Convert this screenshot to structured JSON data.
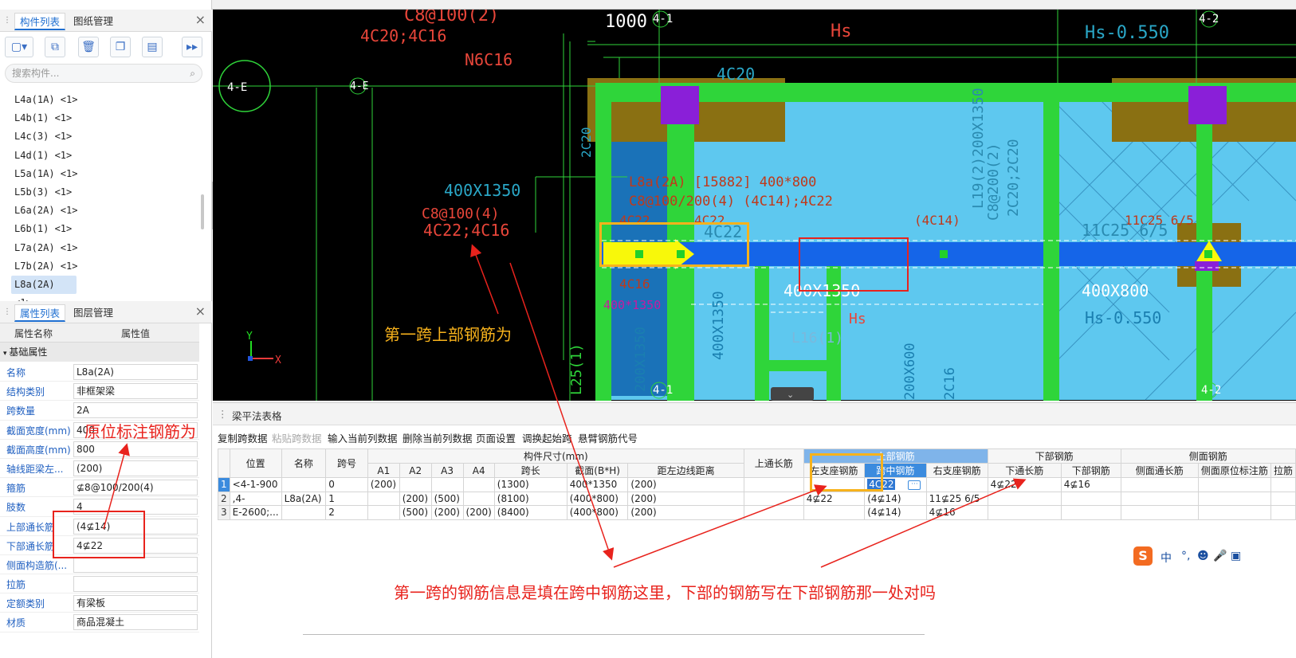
{
  "left_top_panel": {
    "tabs": [
      {
        "label": "构件列表"
      },
      {
        "label": "图纸管理"
      }
    ],
    "close": "×",
    "search_placeholder": "搜索构件...",
    "items": [
      "L4a(1A) <1>",
      "L4b(1) <1>",
      "L4c(3) <1>",
      "L4d(1) <1>",
      "L5a(1A) <1>",
      "L5b(3) <1>",
      "L6a(2A) <1>",
      "L6b(1) <1>",
      "L7a(2A) <1>",
      "L7b(2A) <1>",
      "L8a(2A) <1>"
    ],
    "selected_item": "L8a(2A) <1>"
  },
  "prop_panel": {
    "tabs": [
      {
        "label": "属性列表"
      },
      {
        "label": "图层管理"
      }
    ],
    "close": "×",
    "col_name": "属性名称",
    "col_value": "属性值",
    "group": "基础属性",
    "rows": [
      {
        "name": "名称",
        "value": "L8a(2A)"
      },
      {
        "name": "结构类别",
        "value": "非框架梁"
      },
      {
        "name": "跨数量",
        "value": "2A"
      },
      {
        "name": "截面宽度(mm)",
        "value": "400"
      },
      {
        "name": "截面高度(mm)",
        "value": "800"
      },
      {
        "name": "轴线距梁左...",
        "value": "(200)"
      },
      {
        "name": "箍筋",
        "value": "⊈8@100/200(4)"
      },
      {
        "name": "肢数",
        "value": "4"
      },
      {
        "name": "上部通长筋",
        "value": "(4⊈14)"
      },
      {
        "name": "下部通长筋",
        "value": "4⊈22"
      },
      {
        "name": "侧面构造筋(...",
        "value": ""
      },
      {
        "name": "拉筋",
        "value": ""
      },
      {
        "name": "定额类别",
        "value": "有梁板"
      },
      {
        "name": "材质",
        "value": "商品混凝土"
      }
    ]
  },
  "cad": {
    "labels": {
      "c8_100": "C8@100(2)",
      "c20_16": "4C20;4C16",
      "dim1000": "1000",
      "axis41": "4-1",
      "hs": "Hs",
      "hs055": "Hs-0.550",
      "axis42": "4-2",
      "n6c16": "N6C16",
      "axis4e_circle": "4-E",
      "axis4e": "4-E",
      "c20": "4C20",
      "c20v": "2C20",
      "l19": "L19(2)200X1350",
      "c8_200": "C8@200(2)",
      "c20c20": "2C20;2C20",
      "beam_name": "L8a(2A) [15882] 400*800",
      "beam_stir": "C8@100/200(4) (4C14);4C22",
      "sec400": "400X1350",
      "c8_100_4": "C8@100(4)",
      "c22_16": "4C22;4C16",
      "c22a": "4C22",
      "c22b": "4C22",
      "c22c": "4C22",
      "c14": "(4C14)",
      "c25": "11C25 6/5",
      "c25b": "11C25 6/5",
      "c16": "4C16",
      "sec400b": "400*1350",
      "sec400c": "400X1350",
      "sec400v": "400X1350",
      "sec400d": "400X800",
      "hs2": "Hs",
      "hs055b": "Hs-0.550",
      "l16": "L16(1)",
      "l25": "L25(1)",
      "sec200": "200X1350",
      "sec200b": "200X600",
      "c16v": "2C16",
      "axis41b": "4-1",
      "axis42b": "4-2",
      "y": "Y",
      "x": "X"
    }
  },
  "table_panel": {
    "title": "梁平法表格",
    "toolbar": [
      "复制跨数据",
      "粘贴跨数据",
      "输入当前列数据",
      "删除当前列数据",
      "页面设置",
      "调换起始跨",
      "悬臂钢筋代号"
    ],
    "headers": {
      "pos": "位置",
      "name": "名称",
      "span": "跨号",
      "dims": "构件尺寸(mm)",
      "a1": "A1",
      "a2": "A2",
      "a3": "A3",
      "a4": "A4",
      "len": "跨长",
      "sec": "截面(B*H)",
      "dist": "距左边线距离",
      "top_through": "上通长筋",
      "top_bar": "上部钢筋",
      "left_support": "左支座钢筋",
      "mid": "跨中钢筋",
      "right_support": "右支座钢筋",
      "bottom_bar": "下部钢筋",
      "bottom_through": "下通长筋",
      "bottom": "下部钢筋",
      "side_bar": "侧面钢筋",
      "side_through": "侧面通长筋",
      "side_orig": "侧面原位标注筋",
      "tie": "拉筋"
    },
    "rows": [
      {
        "rn": "1",
        "pos": "<4-1-900",
        "name": "",
        "span": "0",
        "a1": "(200)",
        "a2": "",
        "a3": "",
        "a4": "",
        "len": "(1300)",
        "sec": "400*1350",
        "dist": "(200)",
        "top_through": "",
        "left": "",
        "mid": "4C22",
        "right": "",
        "bthrough": "4⊈22",
        "bottom": "4⊈16",
        "sthrough": "",
        "sorig": "",
        "tie": ""
      },
      {
        "rn": "2",
        "pos": ",4-",
        "name": "L8a(2A)",
        "span": "1",
        "a1": "",
        "a2": "(200)",
        "a3": "(500)",
        "a4": "",
        "len": "(8100)",
        "sec": "(400*800)",
        "dist": "(200)",
        "top_through": "",
        "left": "4⊈22",
        "mid": "(4⊈14)",
        "right": "11⊈25 6/5",
        "bthrough": "",
        "bottom": "",
        "sthrough": "",
        "sorig": "",
        "tie": ""
      },
      {
        "rn": "3",
        "pos": "E-2600;...",
        "name": "",
        "span": "2",
        "a1": "",
        "a2": "(500)",
        "a3": "(200)",
        "a4": "(200)",
        "len": "(8400)",
        "sec": "(400*800)",
        "dist": "(200)",
        "top_through": "",
        "left": "",
        "mid": "(4⊈14)",
        "right": "4⊈16",
        "bthrough": "",
        "bottom": "",
        "sthrough": "",
        "sorig": "",
        "tie": ""
      }
    ]
  },
  "ime": {
    "logo": "S",
    "lang": "中",
    "punct": "°,",
    "emoji": "☻",
    "mic": "🎤",
    "settings": "▣"
  },
  "annotations": {
    "first_span_top": "第一跨上部钢筋为",
    "in_place": "原位标注钢筋为",
    "question": "第一跨的钢筋信息是填在跨中钢筋这里，下部的钢筋写在下部钢筋那一处对吗"
  }
}
